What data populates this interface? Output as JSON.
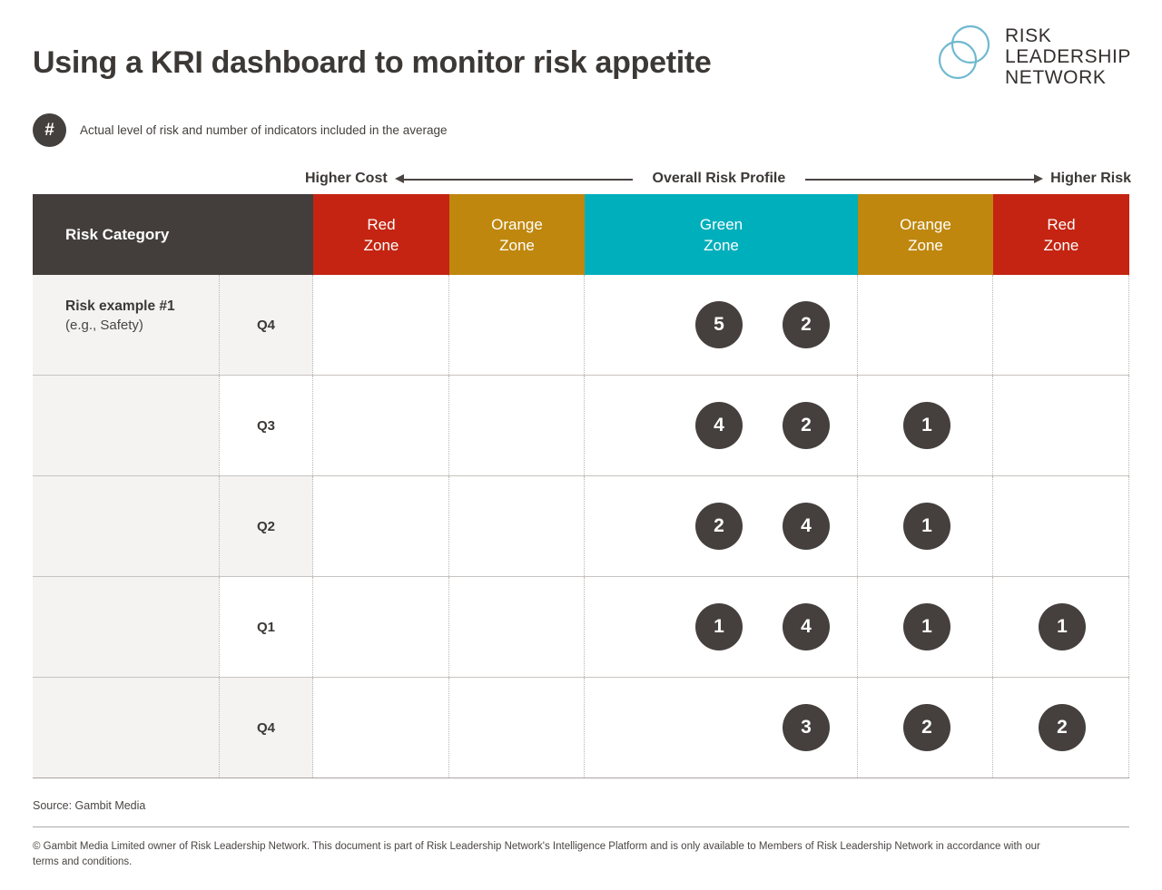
{
  "header": {
    "title": "Using a KRI dashboard to monitor risk appetite",
    "logo": {
      "line1": "RISK",
      "line2": "LEADERSHIP",
      "line3": "NETWORK",
      "mark_color": "#63b3cc"
    }
  },
  "legend": {
    "badge": "#",
    "text": "Actual level of risk and number of indicators included in the average"
  },
  "axis": {
    "left_label": "Higher Cost",
    "center_label": "Overall Risk Profile",
    "right_label": "Higher Risk"
  },
  "table": {
    "category_header": "Risk Category",
    "zone_headers": [
      {
        "line1": "Red",
        "line2": "Zone",
        "color": "#c42411"
      },
      {
        "line1": "Orange",
        "line2": "Zone",
        "color": "#bf870d"
      },
      {
        "line1": "Green",
        "line2": "Zone",
        "color": "#00afbc"
      },
      {
        "line1": "Orange",
        "line2": "Zone",
        "color": "#bf870d"
      },
      {
        "line1": "Red",
        "line2": "Zone",
        "color": "#c42411"
      }
    ],
    "category": {
      "name": "Risk example #1",
      "detail": "(e.g., Safety)"
    },
    "rows": [
      {
        "quarter": "Q4"
      },
      {
        "quarter": "Q3"
      },
      {
        "quarter": "Q2"
      },
      {
        "quarter": "Q1"
      },
      {
        "quarter": "Q4"
      }
    ]
  },
  "footer": {
    "source": "Source: Gambit Media",
    "copyright": "© Gambit Media Limited owner of Risk Leadership Network.  This document is part of Risk Leadership Network's Intelligence Platform and is only available to Members of Risk Leadership Network in accordance with our terms and conditions."
  },
  "chart_data": {
    "type": "heatmap",
    "title": "Using a KRI dashboard to monitor risk appetite",
    "xlabel": "Overall Risk Profile",
    "ylabel": "Risk Category",
    "categories": [
      "Red Zone",
      "Orange Zone",
      "Green Zone",
      "Orange Zone",
      "Red Zone"
    ],
    "rows": [
      "Q4",
      "Q3",
      "Q2",
      "Q1",
      "Q4"
    ],
    "marker_label_meaning": "Number of indicators included in the average",
    "points": [
      {
        "row": "Q4",
        "zone": "Green Zone",
        "slot": 2,
        "value": "5"
      },
      {
        "row": "Q4",
        "zone": "Green Zone",
        "slot": 3,
        "value": "2"
      },
      {
        "row": "Q3",
        "zone": "Green Zone",
        "slot": 2,
        "value": "4"
      },
      {
        "row": "Q3",
        "zone": "Green Zone",
        "slot": 3,
        "value": "2"
      },
      {
        "row": "Q3",
        "zone": "Orange Zone (right)",
        "slot": 1,
        "value": "1"
      },
      {
        "row": "Q2",
        "zone": "Green Zone",
        "slot": 2,
        "value": "2"
      },
      {
        "row": "Q2",
        "zone": "Green Zone",
        "slot": 3,
        "value": "4"
      },
      {
        "row": "Q2",
        "zone": "Orange Zone (right)",
        "slot": 1,
        "value": "1"
      },
      {
        "row": "Q1",
        "zone": "Green Zone",
        "slot": 2,
        "value": "1"
      },
      {
        "row": "Q1",
        "zone": "Green Zone",
        "slot": 3,
        "value": "4"
      },
      {
        "row": "Q1",
        "zone": "Orange Zone (right)",
        "slot": 1,
        "value": "1"
      },
      {
        "row": "Q1",
        "zone": "Red Zone (right)",
        "slot": 1,
        "value": "1"
      },
      {
        "row": "Q4b",
        "zone": "Green Zone",
        "slot": 3,
        "value": "3"
      },
      {
        "row": "Q4b",
        "zone": "Orange Zone (right)",
        "slot": 1,
        "value": "2"
      },
      {
        "row": "Q4b",
        "zone": "Red Zone (right)",
        "slot": 1,
        "value": "2"
      }
    ],
    "cells": [
      {
        "quarter": "Q4",
        "red_left": [],
        "orange_left": [],
        "green": [
          "5",
          "2"
        ],
        "orange_right": [],
        "red_right": []
      },
      {
        "quarter": "Q3",
        "red_left": [],
        "orange_left": [],
        "green": [
          "4",
          "2"
        ],
        "orange_right": [
          "1"
        ],
        "red_right": []
      },
      {
        "quarter": "Q2",
        "red_left": [],
        "orange_left": [],
        "green": [
          "2",
          "4"
        ],
        "orange_right": [
          "1"
        ],
        "red_right": []
      },
      {
        "quarter": "Q1",
        "red_left": [],
        "orange_left": [],
        "green": [
          "1",
          "4"
        ],
        "orange_right": [
          "1"
        ],
        "red_right": [
          "1"
        ]
      },
      {
        "quarter": "Q4",
        "red_left": [],
        "orange_left": [],
        "green": [
          "",
          "3"
        ],
        "orange_right": [
          "2"
        ],
        "red_right": [
          "2"
        ]
      }
    ]
  }
}
